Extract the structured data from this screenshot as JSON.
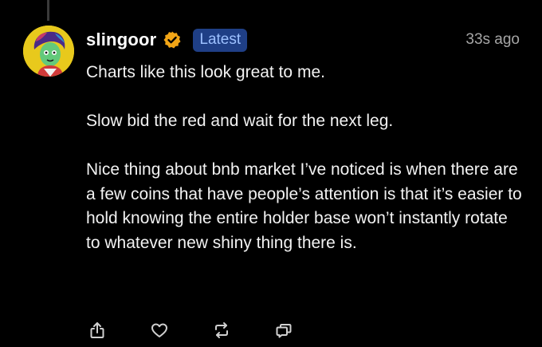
{
  "post": {
    "username": "slingoor",
    "badge": "Latest",
    "timestamp": "33s ago",
    "paragraphs": [
      "Charts like this look great to me.",
      "Slow bid the red and wait for the next leg.",
      "Nice thing about bnb market I’ve noticed is when there are a few coins that have people’s attention is that it’s easier to hold knowing the entire holder base won’t instantly rotate to whatever new shiny thing there is."
    ]
  },
  "actions": {
    "icons": [
      "share-icon",
      "like-icon",
      "repost-icon",
      "reply-icon"
    ]
  },
  "colors": {
    "background": "#000000",
    "badge_bg": "#1f3f86",
    "badge_text": "#9cc0ff",
    "verified": "#f2a516",
    "timestamp": "#a6a6a6",
    "icon": "#d0d0d0"
  }
}
